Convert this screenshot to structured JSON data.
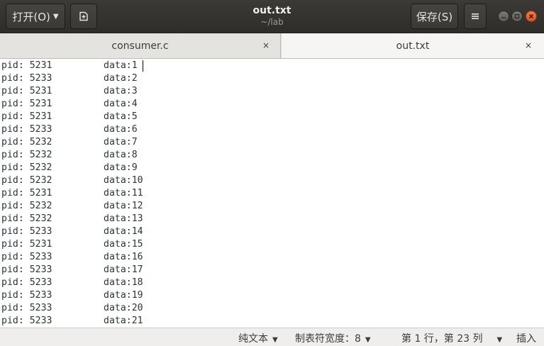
{
  "header": {
    "open_label": "打开(O)",
    "save_label": "保存(S)",
    "title": "out.txt",
    "subtitle": "~/lab"
  },
  "tabs": [
    {
      "label": "consumer.c",
      "close": "×"
    },
    {
      "label": "out.txt",
      "close": "×"
    }
  ],
  "lines": [
    {
      "pid": "pid: 5231",
      "data": "data:1"
    },
    {
      "pid": "pid: 5233",
      "data": "data:2"
    },
    {
      "pid": "pid: 5231",
      "data": "data:3"
    },
    {
      "pid": "pid: 5231",
      "data": "data:4"
    },
    {
      "pid": "pid: 5231",
      "data": "data:5"
    },
    {
      "pid": "pid: 5233",
      "data": "data:6"
    },
    {
      "pid": "pid: 5232",
      "data": "data:7"
    },
    {
      "pid": "pid: 5232",
      "data": "data:8"
    },
    {
      "pid": "pid: 5232",
      "data": "data:9"
    },
    {
      "pid": "pid: 5232",
      "data": "data:10"
    },
    {
      "pid": "pid: 5231",
      "data": "data:11"
    },
    {
      "pid": "pid: 5232",
      "data": "data:12"
    },
    {
      "pid": "pid: 5232",
      "data": "data:13"
    },
    {
      "pid": "pid: 5233",
      "data": "data:14"
    },
    {
      "pid": "pid: 5231",
      "data": "data:15"
    },
    {
      "pid": "pid: 5233",
      "data": "data:16"
    },
    {
      "pid": "pid: 5233",
      "data": "data:17"
    },
    {
      "pid": "pid: 5233",
      "data": "data:18"
    },
    {
      "pid": "pid: 5233",
      "data": "data:19"
    },
    {
      "pid": "pid: 5233",
      "data": "data:20"
    },
    {
      "pid": "pid: 5233",
      "data": "data:21"
    }
  ],
  "status": {
    "language": "纯文本",
    "tab_width": "制表符宽度：8",
    "position": "第 1 行，第 23 列",
    "mode": "插入"
  },
  "icons": {
    "new_document": "new-document-icon",
    "menu": "hamburger-menu-icon",
    "minimize": "minimize-icon",
    "maximize": "maximize-icon",
    "close": "close-icon"
  },
  "colors": {
    "headerbar": "#2e2d2a",
    "close_button": "#e0531c",
    "active_tab": "#f6f5f4",
    "inactive_tab": "#e4e3e0"
  }
}
